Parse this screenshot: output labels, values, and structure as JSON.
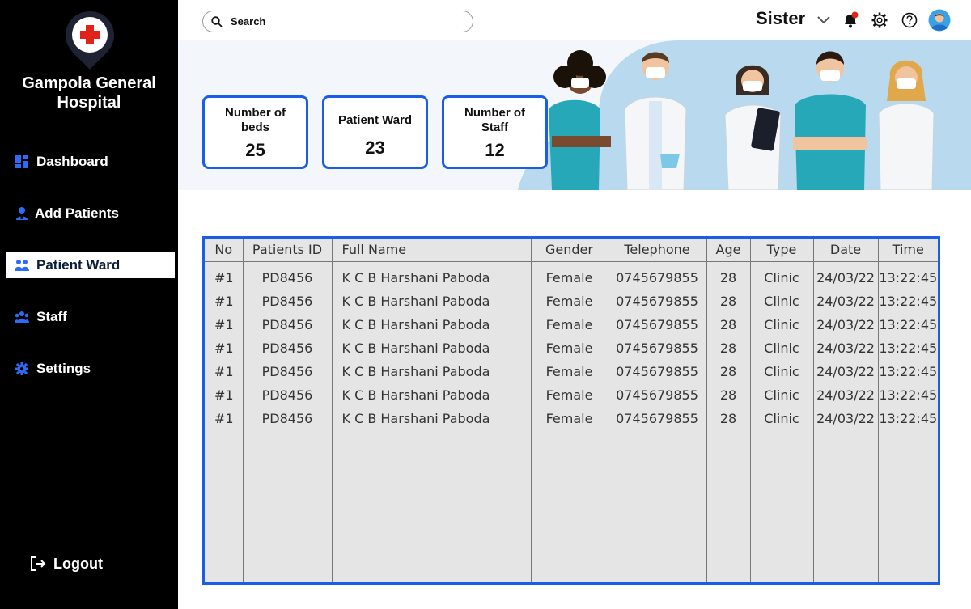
{
  "sidebar": {
    "hospital_name": "Gampola General Hospital",
    "items": [
      {
        "label": "Dashboard",
        "icon": "dashboard-icon"
      },
      {
        "label": "Add Patients",
        "icon": "add-patient-icon"
      },
      {
        "label": "Patient Ward",
        "icon": "patient-ward-icon"
      },
      {
        "label": "Staff",
        "icon": "staff-icon"
      },
      {
        "label": "Settings",
        "icon": "settings-icon"
      }
    ],
    "active_item": "Patient Ward",
    "logout_label": "Logout"
  },
  "topbar": {
    "search_placeholder": "Search",
    "user_name": "Sister"
  },
  "stats": [
    {
      "label": "Number of beds",
      "value": "25"
    },
    {
      "label": "Patient Ward",
      "value": "23"
    },
    {
      "label": "Number of Staff",
      "value": "12"
    }
  ],
  "table": {
    "headers": [
      "No",
      "Patients ID",
      "Full Name",
      "Gender",
      "Telephone",
      "Age",
      "Type",
      "Date",
      "Time"
    ],
    "rows": [
      [
        "#1",
        "PD8456",
        "K C B Harshani Paboda",
        "Female",
        "0745679855",
        "28",
        "Clinic",
        "24/03/22",
        "13:22:45"
      ],
      [
        "#1",
        "PD8456",
        "K C B Harshani Paboda",
        "Female",
        "0745679855",
        "28",
        "Clinic",
        "24/03/22",
        "13:22:45"
      ],
      [
        "#1",
        "PD8456",
        "K C B Harshani Paboda",
        "Female",
        "0745679855",
        "28",
        "Clinic",
        "24/03/22",
        "13:22:45"
      ],
      [
        "#1",
        "PD8456",
        "K C B Harshani Paboda",
        "Female",
        "0745679855",
        "28",
        "Clinic",
        "24/03/22",
        "13:22:45"
      ],
      [
        "#1",
        "PD8456",
        "K C B Harshani Paboda",
        "Female",
        "0745679855",
        "28",
        "Clinic",
        "24/03/22",
        "13:22:45"
      ],
      [
        "#1",
        "PD8456",
        "K C B Harshani Paboda",
        "Female",
        "0745679855",
        "28",
        "Clinic",
        "24/03/22",
        "13:22:45"
      ],
      [
        "#1",
        "PD8456",
        "K C B Harshani Paboda",
        "Female",
        "0745679855",
        "28",
        "Clinic",
        "24/03/22",
        "13:22:45"
      ]
    ]
  },
  "colors": {
    "accent": "#1a5de8",
    "sidebar_bg": "#000000",
    "table_bg": "#e5e5e5",
    "banner_bg": "#f3f6fb"
  }
}
